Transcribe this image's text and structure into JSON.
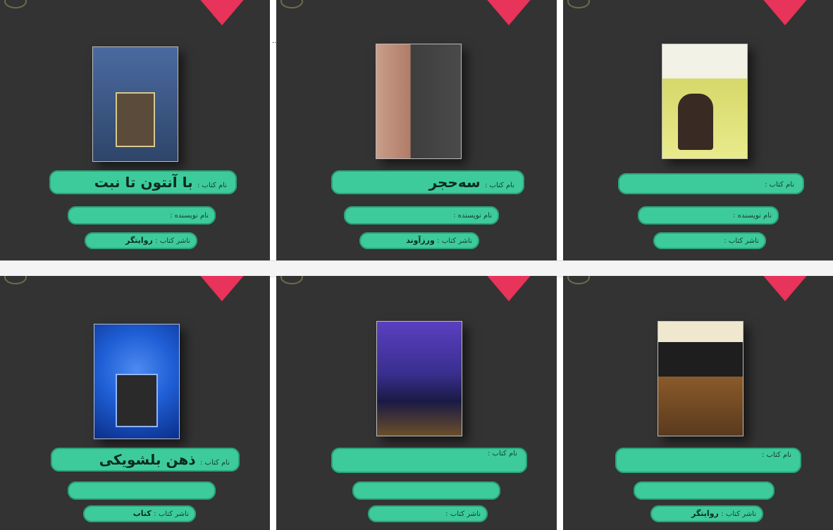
{
  "books": [
    {
      "cover_colors": [
        "#3f5d8c",
        "#2f4569"
      ],
      "cover_title": "",
      "rows": [
        {
          "label": "نام کتاب :",
          "value": "با آنتون تا نبت"
        },
        {
          "label": "نام نویسنده :",
          "value": ""
        },
        {
          "label": "ناشر کتاب :",
          "value": "روایتگر"
        }
      ]
    },
    {
      "cover_colors": [
        "#c99e8a",
        "#4a4a4a"
      ],
      "cover_title": "",
      "rows": [
        {
          "label": "نام کتاب :",
          "value": "سه‌حجر"
        },
        {
          "label": "نام نویسنده :",
          "value": ""
        },
        {
          "label": "ناشر کتاب :",
          "value": "ورزآوند"
        }
      ]
    },
    {
      "cover_colors": [
        "#f2f2e6",
        "#d6d86a"
      ],
      "cover_title": "",
      "rows": [
        {
          "label": "نام کتاب :",
          "value": ""
        },
        {
          "label": "نام نویسنده :",
          "value": ""
        },
        {
          "label": "ناشر کتاب :",
          "value": ""
        }
      ]
    },
    {
      "cover_colors": [
        "#1f5fd6",
        "#0b2e8a"
      ],
      "cover_title": "",
      "rows": [
        {
          "label": "نام کتاب :",
          "value": "ذهن بلشویکی"
        },
        {
          "label": "",
          "value": ""
        },
        {
          "label": "ناشر کتاب :",
          "value": "کتاب"
        }
      ]
    },
    {
      "cover_colors": [
        "#3a2f8f",
        "#1a1a44"
      ],
      "cover_title": "",
      "rows": [
        {
          "label": "نام کتاب :",
          "value": ""
        },
        {
          "label": "",
          "value": ""
        },
        {
          "label": "ناشر کتاب :",
          "value": ""
        }
      ]
    },
    {
      "cover_colors": [
        "#efe8cf",
        "#5a3a1e"
      ],
      "cover_title": "",
      "rows": [
        {
          "label": "نام کتاب :",
          "value": ""
        },
        {
          "label": "",
          "value": ""
        },
        {
          "label": "ناشر کتاب :",
          "value": "روایتگر"
        }
      ]
    }
  ],
  "strip": {
    "segments": [
      "",
      "",
      ""
    ]
  },
  "colors": {
    "card_bg": "#333333",
    "plate": "#3ecb9c",
    "ribbon": "#e8335a"
  }
}
